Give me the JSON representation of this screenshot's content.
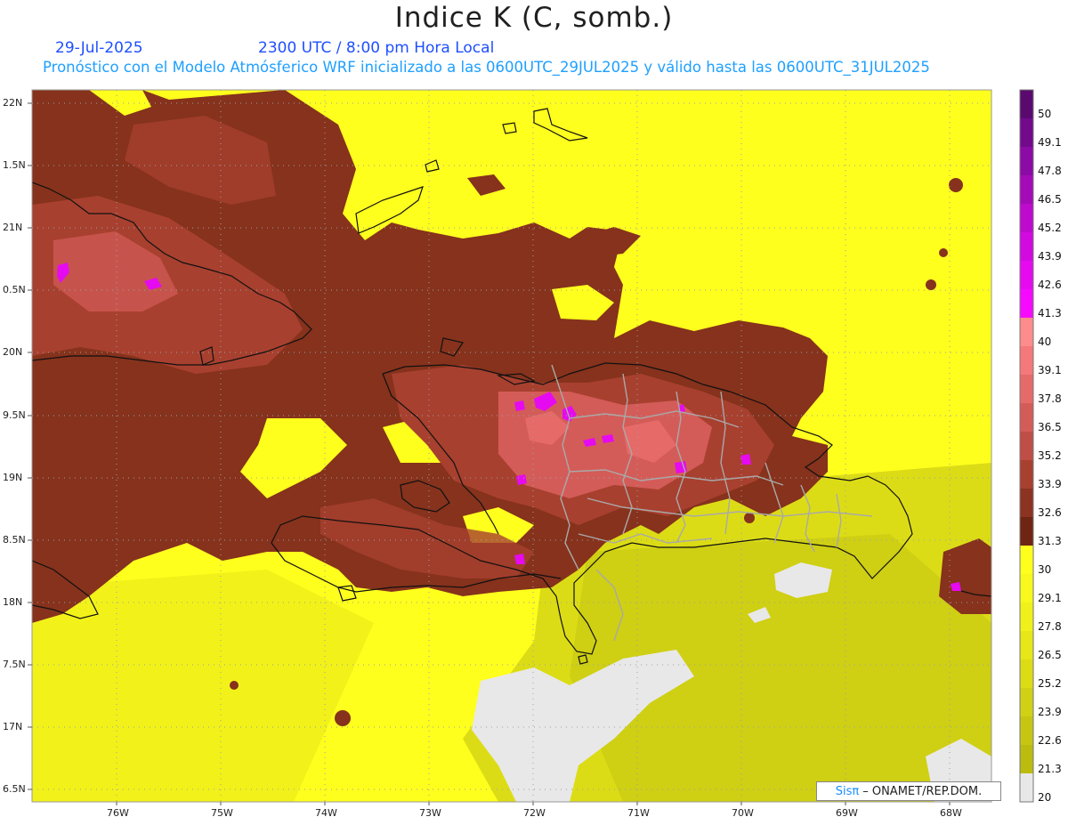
{
  "title": "Indice K (C, somb.)",
  "date": "29-Jul-2025",
  "time": "2300 UTC / 8:00 pm Hora Local",
  "forecast_info": "Pronóstico con el Modelo Atmósferico WRF inicializado a las 0600UTC_29JUL2025 y válido hasta las  0600UTC_31JUL2025",
  "credit": {
    "brand": "Sisπ",
    "text": "– ONAMET/REP.DOM."
  },
  "axes": {
    "lon": [
      "76W",
      "75W",
      "74W",
      "73W",
      "72W",
      "71W",
      "70W",
      "69W",
      "68W"
    ],
    "lat": [
      "22N",
      "1.5N",
      "21N",
      "0.5N",
      "20N",
      "9.5N",
      "19N",
      "8.5N",
      "18N",
      "7.5N",
      "17N",
      "6.5N"
    ]
  },
  "colorbar": {
    "labels": [
      "50",
      "49.1",
      "47.8",
      "46.5",
      "45.2",
      "43.9",
      "42.6",
      "41.3",
      "40",
      "39.1",
      "37.8",
      "36.5",
      "35.2",
      "33.9",
      "32.6",
      "31.3",
      "30",
      "29.1",
      "27.8",
      "26.5",
      "25.2",
      "23.9",
      "22.6",
      "21.3",
      "20"
    ],
    "colors": [
      "#5a0a6e",
      "#730a8c",
      "#8c0aa5",
      "#a50ab9",
      "#be0acd",
      "#d20ae1",
      "#e60af0",
      "#f50aff",
      "#ff8c8c",
      "#f5787a",
      "#e66a68",
      "#d45c58",
      "#bf4e47",
      "#a8402f",
      "#8c3322",
      "#6e2514",
      "#ffff1e",
      "#f8f81c",
      "#f0f01a",
      "#e6e618",
      "#dcdc16",
      "#d0d014",
      "#c6c612",
      "#bcbc10",
      "#e8e8e8"
    ]
  }
}
